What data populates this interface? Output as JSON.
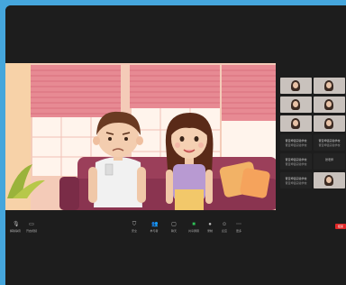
{
  "meeting": {
    "status_text": ""
  },
  "participants": [
    {
      "name": "",
      "sub": "",
      "kind": "video"
    },
    {
      "name": "",
      "sub": "",
      "kind": "video"
    },
    {
      "name": "",
      "sub": "",
      "kind": "video"
    },
    {
      "name": "",
      "sub": "",
      "kind": "video"
    },
    {
      "name": "",
      "sub": "",
      "kind": "video"
    },
    {
      "name": "",
      "sub": "",
      "kind": "video"
    },
    {
      "name": "晋亚坤铭实验学校",
      "sub": "晋亚坤铭实验学校",
      "kind": "dark"
    },
    {
      "name": "晋亚坤铭实验学校",
      "sub": "晋亚坤铭实验学校",
      "kind": "dark"
    },
    {
      "name": "晋亚坤铭实验学校",
      "sub": "晋亚坤铭实验学校",
      "kind": "dark"
    },
    {
      "name": "张老师",
      "sub": "",
      "kind": "dark"
    },
    {
      "name": "晋亚坤铭实验学校",
      "sub": "晋亚坤铭实验学校",
      "kind": "dark"
    },
    {
      "name": "",
      "sub": "",
      "kind": "video"
    }
  ],
  "toolbar": {
    "items": [
      {
        "label": "解除静音",
        "icon": "mic-icon"
      },
      {
        "label": "开启视频",
        "icon": "camera-icon"
      },
      {
        "label": "安全",
        "icon": "shield-icon"
      },
      {
        "label": "参与者",
        "icon": "people-icon"
      },
      {
        "label": "聊天",
        "icon": "chat-icon"
      },
      {
        "label": "共享屏幕",
        "icon": "share-icon"
      },
      {
        "label": "录制",
        "icon": "record-icon"
      },
      {
        "label": "反应",
        "icon": "reaction-icon"
      },
      {
        "label": "更多",
        "icon": "more-icon"
      }
    ],
    "end_label": "结束"
  },
  "colors": {
    "share_green": "#2fc057",
    "end_red": "#e02828",
    "frame_blue": "#45a6dc"
  }
}
